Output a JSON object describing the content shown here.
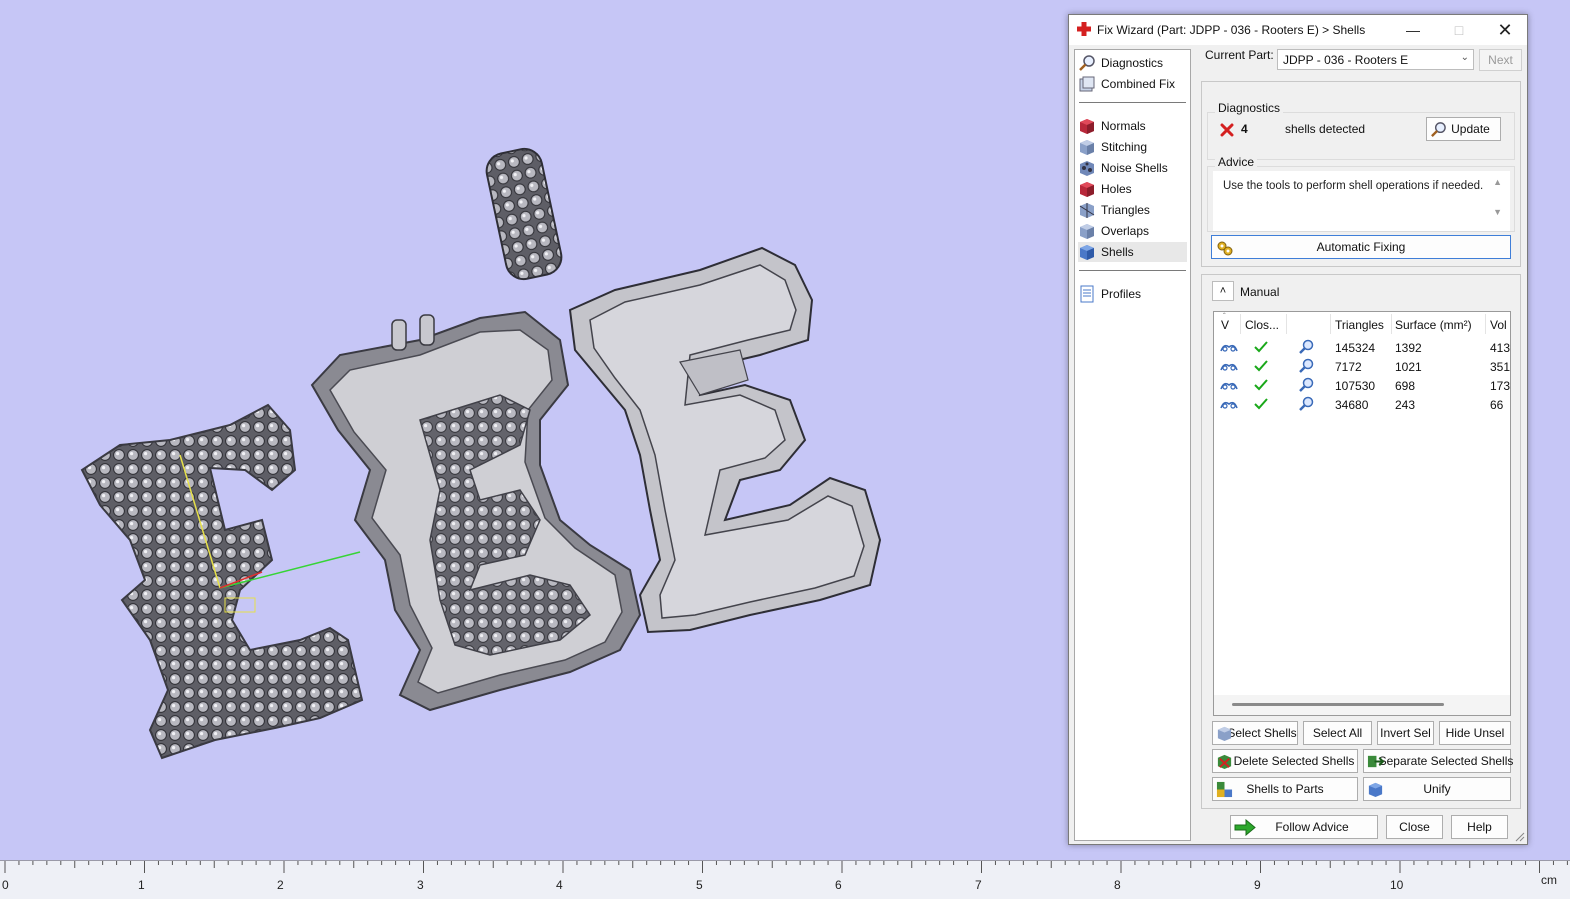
{
  "dialog": {
    "title": "Fix Wizard (Part: JDPP - 036 - Rooters E) > Shells",
    "nav": {
      "top_items": [
        {
          "label": "Diagnostics",
          "icon": "magnifier-icon"
        },
        {
          "label": "Combined Fix",
          "icon": "combined-fix-icon"
        }
      ],
      "tool_items": [
        {
          "label": "Normals",
          "icon": "normals-icon"
        },
        {
          "label": "Stitching",
          "icon": "stitching-icon"
        },
        {
          "label": "Noise Shells",
          "icon": "noise-shells-icon"
        },
        {
          "label": "Holes",
          "icon": "holes-icon"
        },
        {
          "label": "Triangles",
          "icon": "triangles-icon"
        },
        {
          "label": "Overlaps",
          "icon": "overlaps-icon"
        },
        {
          "label": "Shells",
          "icon": "shells-icon",
          "active": true
        }
      ],
      "bottom_items": [
        {
          "label": "Profiles",
          "icon": "profiles-icon"
        }
      ]
    },
    "current_part_label": "Current Part:",
    "current_part_value": "JDPP - 036 - Rooters E",
    "next_label": "Next",
    "diagnostics": {
      "group_label": "Diagnostics",
      "count": "4",
      "status_text": "shells detected",
      "update_label": "Update"
    },
    "advice": {
      "group_label": "Advice",
      "text": "Use the tools to perform shell operations if needed."
    },
    "automatic_fixing_label": "Automatic Fixing",
    "manual": {
      "title": "Manual",
      "columns": [
        "V",
        "Clos...",
        "",
        "Triangles",
        "Surface (mm²)",
        "Vol"
      ],
      "rows": [
        {
          "triangles": "145324",
          "surface": "1392",
          "volume": "413"
        },
        {
          "triangles": "7172",
          "surface": "1021",
          "volume": "351"
        },
        {
          "triangles": "107530",
          "surface": "698",
          "volume": "173"
        },
        {
          "triangles": "34680",
          "surface": "243",
          "volume": "66"
        }
      ],
      "buttons": {
        "select_shells": "Select Shells",
        "select_all": "Select All",
        "invert_sel": "Invert Sel",
        "hide_unsel": "Hide Unsel",
        "delete_selected": "Delete Selected Shells",
        "separate_selected": "Separate Selected Shells",
        "shells_to_parts": "Shells to Parts",
        "unify": "Unify"
      }
    },
    "footer": {
      "follow_advice": "Follow Advice",
      "close": "Close",
      "help": "Help"
    }
  },
  "ruler": {
    "labels": [
      "0",
      "1",
      "2",
      "3",
      "4",
      "5",
      "6",
      "7",
      "8",
      "9",
      "10"
    ],
    "unit": "cm"
  },
  "colors": {
    "viewport_bg": "#c6c6f6",
    "accent_border": "#3f7ed8",
    "check_green": "#1aa81a",
    "error_red": "#d42020"
  }
}
